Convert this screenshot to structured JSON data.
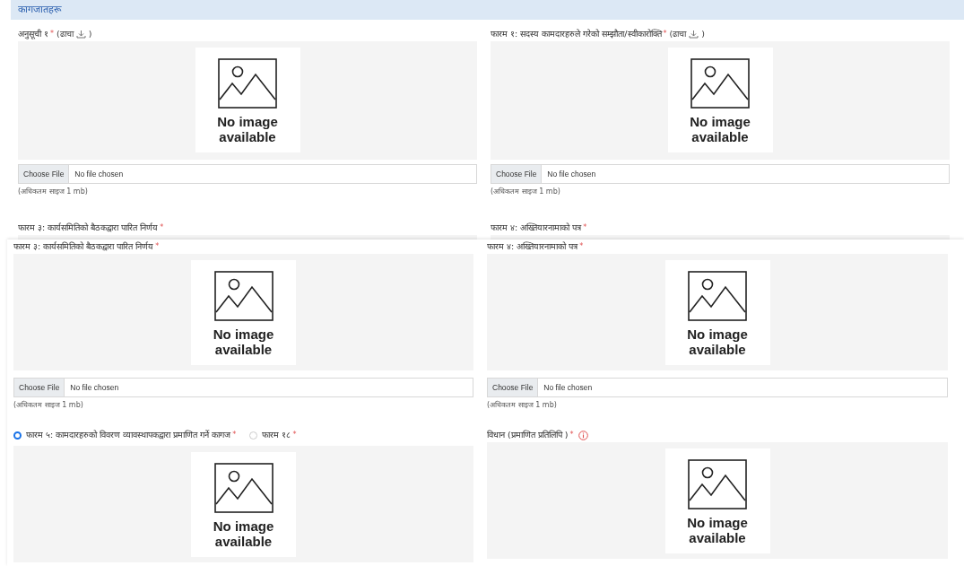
{
  "upper_sheet": {
    "section_title": "कागजातहरू",
    "fields": [
      {
        "kind": "full",
        "label": "अनुसूची १",
        "required_mark": "*",
        "template_open": "(",
        "template_link": "ढाचा",
        "template_close": ")",
        "preview_text": "No image available",
        "file_button": "Choose File",
        "file_status": "No file chosen",
        "hint": "(अधिकतम साइज 1 mb)"
      },
      {
        "kind": "full",
        "label": "फारम १: सदस्य कामदारहरुले गरेको सम्झौता/स्वीकारोक्ति",
        "required_mark": "*",
        "template_open": "(",
        "template_link": "ढाचा",
        "template_close": ")",
        "preview_text": "No image available",
        "file_button": "Choose File",
        "file_status": "No file chosen",
        "hint": "(अधिकतम साइज 1 mb)"
      },
      {
        "kind": "cut",
        "label": "फारम ३: कार्यसमितिको बैठकद्वारा पारित निर्णय",
        "required_mark": "*"
      },
      {
        "kind": "cut",
        "label": "फारम ४: अख्तियारनामाको पत्र",
        "required_mark": "*"
      }
    ]
  },
  "lower_sheet": {
    "fields": [
      {
        "kind": "full",
        "label": "फारम ३: कार्यसमितिको बैठकद्वारा पारित निर्णय",
        "required_mark": "*",
        "preview_text": "No image available",
        "file_button": "Choose File",
        "file_status": "No file chosen",
        "hint": "(अधिकतम साइज 1 mb)"
      },
      {
        "kind": "full",
        "label": "फारम ४: अख्तियारनामाको पत्र",
        "required_mark": "*",
        "preview_text": "No image available",
        "file_button": "Choose File",
        "file_status": "No file chosen",
        "hint": "(अधिकतम साइज 1 mb)"
      },
      {
        "kind": "choice",
        "options": [
          {
            "label": "फारम ५: कामदारहरुको विवरण व्यावस्थापकद्वारा प्रमाणित गर्ने कागज",
            "required_mark": "*",
            "selected": true
          },
          {
            "label": "फारम १८",
            "required_mark": "*",
            "selected": false
          }
        ],
        "preview_text": "No image available"
      },
      {
        "kind": "full",
        "label": "विधान (प्रमाणित प्रतिलिपि )",
        "required_mark": "*",
        "info": true,
        "preview_text": "No image available"
      }
    ]
  }
}
